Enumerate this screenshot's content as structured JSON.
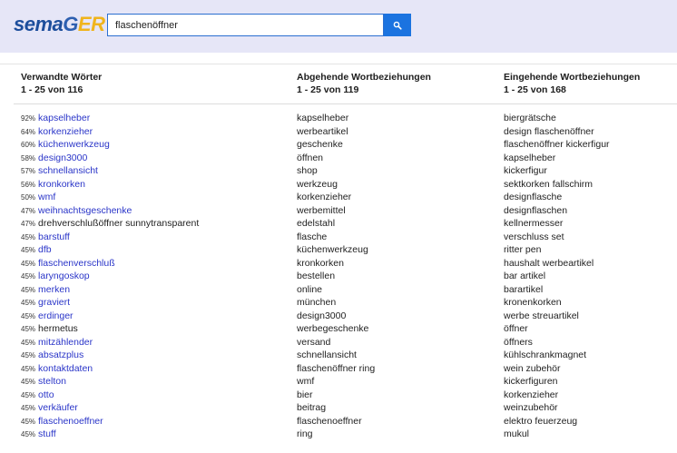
{
  "logo": {
    "part1": "sema",
    "part2": "G",
    "part3": "ER"
  },
  "search": {
    "value": "flaschenöffner",
    "button_icon": "search-icon"
  },
  "columns": {
    "related": {
      "title": "Verwandte Wörter",
      "range": "1 - 25 von 116"
    },
    "outgoing": {
      "title": "Abgehende Wortbeziehungen",
      "range": "1 - 25 von 119"
    },
    "incoming": {
      "title": "Eingehende Wortbeziehungen",
      "range": "1 - 25 von 168"
    }
  },
  "related": [
    {
      "pct": "92%",
      "word": "kapselheber",
      "link": true
    },
    {
      "pct": "64%",
      "word": "korkenzieher",
      "link": true
    },
    {
      "pct": "60%",
      "word": "küchenwerkzeug",
      "link": true
    },
    {
      "pct": "58%",
      "word": "design3000",
      "link": true
    },
    {
      "pct": "57%",
      "word": "schnellansicht",
      "link": true
    },
    {
      "pct": "56%",
      "word": "kronkorken",
      "link": true
    },
    {
      "pct": "50%",
      "word": "wmf",
      "link": true
    },
    {
      "pct": "47%",
      "word": "weihnachtsgeschenke",
      "link": true
    },
    {
      "pct": "47%",
      "word": "drehverschlußöffner sunnytransparent",
      "link": false
    },
    {
      "pct": "45%",
      "word": "barstuff",
      "link": true
    },
    {
      "pct": "45%",
      "word": "dfb",
      "link": true
    },
    {
      "pct": "45%",
      "word": "flaschenverschluß",
      "link": true
    },
    {
      "pct": "45%",
      "word": "laryngoskop",
      "link": true
    },
    {
      "pct": "45%",
      "word": "merken",
      "link": true
    },
    {
      "pct": "45%",
      "word": "graviert",
      "link": true
    },
    {
      "pct": "45%",
      "word": "erdinger",
      "link": true
    },
    {
      "pct": "45%",
      "word": "hermetus",
      "link": false
    },
    {
      "pct": "45%",
      "word": "mitzählender",
      "link": true
    },
    {
      "pct": "45%",
      "word": "absatzplus",
      "link": true
    },
    {
      "pct": "45%",
      "word": "kontaktdaten",
      "link": true
    },
    {
      "pct": "45%",
      "word": "stelton",
      "link": true
    },
    {
      "pct": "45%",
      "word": "otto",
      "link": true
    },
    {
      "pct": "45%",
      "word": "verkäufer",
      "link": true
    },
    {
      "pct": "45%",
      "word": "flaschenoeffner",
      "link": true
    },
    {
      "pct": "45%",
      "word": "stuff",
      "link": true
    }
  ],
  "outgoing": [
    "kapselheber",
    "werbeartikel",
    "geschenke",
    "öffnen",
    "shop",
    "werkzeug",
    "korkenzieher",
    "werbemittel",
    "edelstahl",
    "flasche",
    "küchenwerkzeug",
    "kronkorken",
    "bestellen",
    "online",
    "münchen",
    "design3000",
    "werbegeschenke",
    "versand",
    "schnellansicht",
    "flaschenöffner ring",
    "wmf",
    "bier",
    "beitrag",
    "flaschenoeffner",
    "ring"
  ],
  "incoming": [
    "biergrätsche",
    "design flaschenöffner",
    "flaschenöffner kickerfigur",
    "kapselheber",
    "kickerfigur",
    "sektkorken fallschirm",
    "designflasche",
    "designflaschen",
    "kellnermesser",
    "verschluss set",
    "ritter pen",
    "haushalt werbeartikel",
    "bar artikel",
    "barartikel",
    "kronenkorken",
    "werbe streuartikel",
    "öffner",
    "öffners",
    "kühlschrankmagnet",
    "wein zubehör",
    "kickerfiguren",
    "korkenzieher",
    "weinzubehör",
    "elektro feuerzeug",
    "mukul"
  ]
}
